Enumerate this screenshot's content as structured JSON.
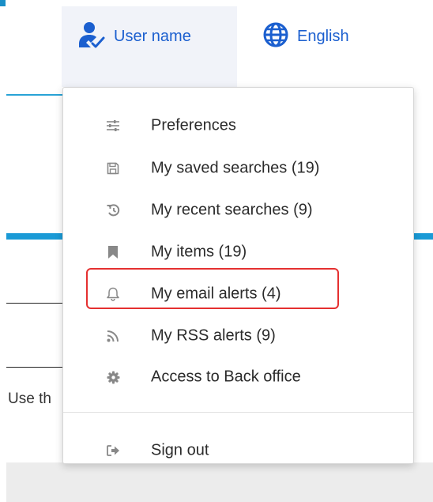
{
  "background": {
    "partial_text": "Use th"
  },
  "header": {
    "user_label": "User name",
    "language_label": "English",
    "user_icon": "user-check-icon",
    "language_icon": "globe-icon",
    "accent_color": "#1b5fcf"
  },
  "menu": {
    "items": [
      {
        "label": "Preferences",
        "icon": "sliders-icon"
      },
      {
        "label": "My saved searches (19)",
        "icon": "floppy-disk-icon"
      },
      {
        "label": "My recent searches (9)",
        "icon": "history-icon"
      },
      {
        "label": "My items (19)",
        "icon": "bookmark-icon"
      },
      {
        "label": "My email alerts (4)",
        "icon": "bell-icon"
      },
      {
        "label": "My RSS alerts (9)",
        "icon": "rss-icon"
      },
      {
        "label": "Access to Back office",
        "icon": "gear-icon"
      }
    ],
    "sign_out": {
      "label": "Sign out",
      "icon": "sign-out-icon"
    },
    "highlight_color": "#e53030"
  }
}
